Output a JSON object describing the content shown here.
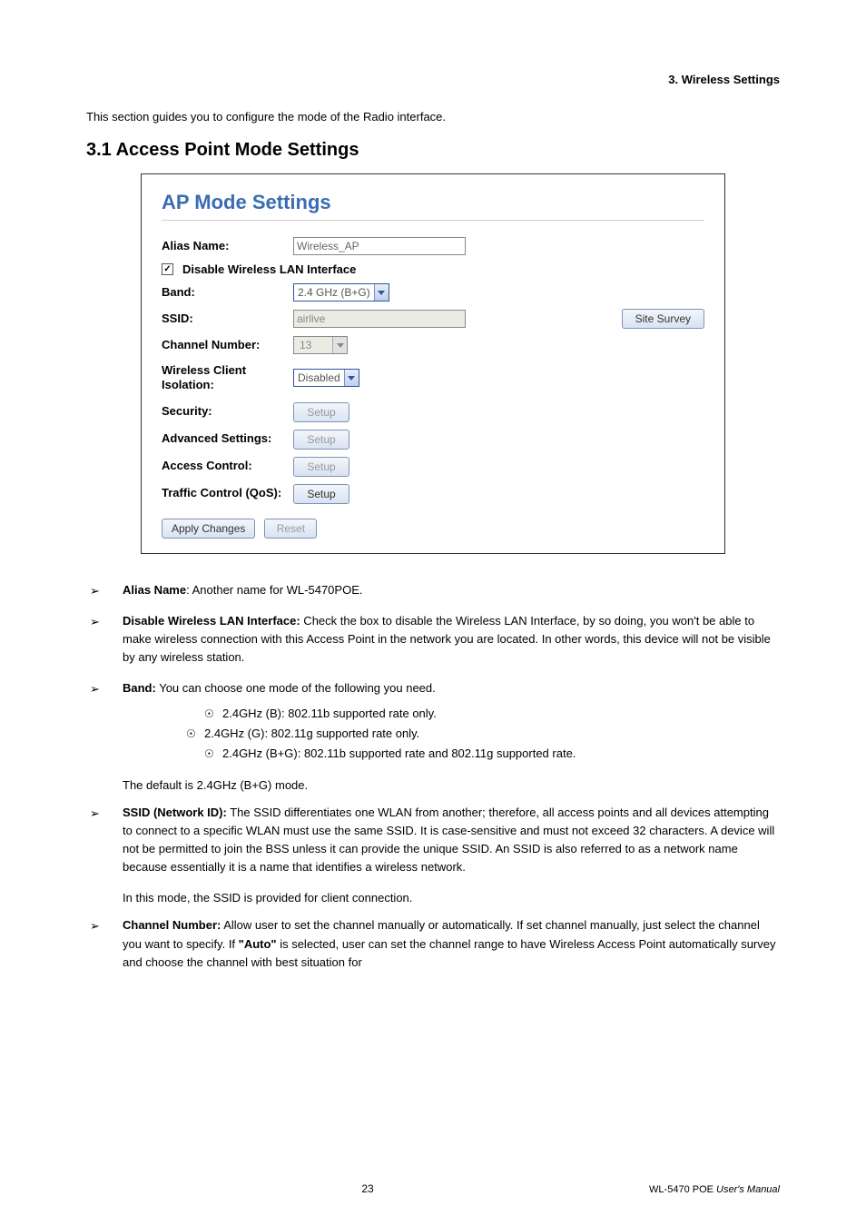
{
  "header": {
    "section_label": "3. Wireless Settings",
    "intro": "This section guides you to configure the mode of the Radio interface.",
    "subsection": "3.1 Access Point Mode Settings"
  },
  "panel": {
    "title": "AP Mode Settings",
    "alias_label": "Alias Name:",
    "alias_value": "Wireless_AP",
    "disable_label": "Disable Wireless LAN Interface",
    "disable_checked": "✓",
    "band_label": "Band:",
    "band_value": "2.4 GHz (B+G)",
    "ssid_label": "SSID:",
    "ssid_value": "airlive",
    "site_survey": "Site Survey",
    "channel_label": "Channel Number:",
    "channel_value": "13",
    "isolation_label": "Wireless Client Isolation:",
    "isolation_value": "Disabled",
    "security_label": "Security:",
    "security_btn": "Setup",
    "advanced_label": "Advanced Settings:",
    "advanced_btn": "Setup",
    "access_label": "Access Control:",
    "access_btn": "Setup",
    "traffic_label": "Traffic Control (QoS):",
    "traffic_btn": "Setup",
    "apply_btn": "Apply Changes",
    "reset_btn": "Reset"
  },
  "bullets": {
    "alias": {
      "label": "Alias Name",
      "text": ": Another name for WL-5470POE."
    },
    "disable": {
      "label": "Disable Wireless LAN Interface:",
      "text": " Check the box to disable the Wireless LAN Interface, by so doing, you won't be able to make wireless connection with this Access Point in the network you are located. In other words, this device will not be visible by any wireless station."
    },
    "band": {
      "label": "Band:",
      "text": " You can choose one mode of the following you need."
    },
    "band_items": {
      "b": "2.4GHz (B): 802.11b supported rate only.",
      "g": "2.4GHz (G): 802.11g supported rate only.",
      "bg": "2.4GHz (B+G): 802.11b supported rate and 802.11g supported rate."
    },
    "band_default": "The default is 2.4GHz (B+G) mode.",
    "ssid": {
      "label": "SSID (Network ID):",
      "text": " The SSID differentiates one WLAN from another; therefore, all access points and all devices attempting to connect to a specific WLAN must use the same SSID. It is case-sensitive and must not exceed 32 characters.   A device will not be permitted to join the BSS unless it can provide the unique SSID. An SSID is also referred to as a network name because essentially it is a name that identifies a wireless network."
    },
    "ssid_mode": "In this mode, the SSID is provided for client connection.",
    "channel": {
      "label": "Channel Number:",
      "text1": " Allow user to set the channel manually or automatically. If set channel manually, just select the channel you want to specify. If ",
      "auto": "\"Auto\"",
      "text2": " is selected, user can set the channel range to have Wireless Access Point automatically survey and choose the channel with best situation for"
    }
  },
  "footer": {
    "page": "23",
    "model_prefix": "WL-5470 POE ",
    "model_suffix": "User's Manual"
  }
}
